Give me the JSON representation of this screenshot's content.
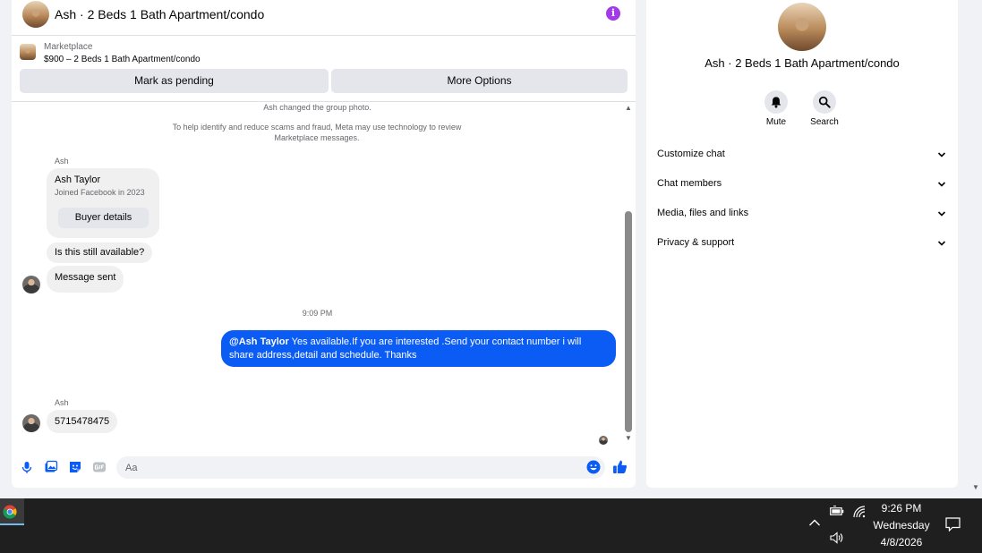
{
  "chat": {
    "title": "Ash · 2 Beds 1 Bath Apartment/condo",
    "listing": {
      "type": "Marketplace",
      "title": "$900 – 2 Beds 1 Bath Apartment/condo"
    },
    "actions": {
      "pending": "Mark as pending",
      "more": "More Options"
    },
    "system_messages": {
      "photo_changed": "Ash changed the group photo.",
      "scam_notice": "To help identify and reduce scams and fraud, Meta may use technology to review Marketplace messages."
    },
    "buyer_card": {
      "sender": "Ash",
      "name": "Ash Taylor",
      "joined": "Joined Facebook in 2023",
      "button": "Buyer details"
    },
    "messages_in_1": [
      "Is this still available?",
      "Message sent"
    ],
    "time_divider": "9:09 PM",
    "outgoing": {
      "mention": "@Ash Taylor",
      "text": "  Yes available.If you are interested .Send your contact number i will share address,detail and schedule. Thanks"
    },
    "last_sender": "Ash",
    "last_message": "5715478475",
    "composer": {
      "placeholder": "Aa"
    }
  },
  "info_panel": {
    "title": "Ash · 2 Beds 1 Bath Apartment/condo",
    "mute_label": "Mute",
    "search_label": "Search",
    "sections": [
      "Customize chat",
      "Chat members",
      "Media, files and links",
      "Privacy & support"
    ]
  },
  "taskbar": {
    "time": "9:26 PM",
    "day": "Wednesday",
    "date": "4/8/2026"
  },
  "colors": {
    "accent": "#0a5cf5",
    "info_icon": "#a33ae8",
    "bubble_in": "#f0f0f0",
    "taskbar": "#1f1f1f"
  },
  "icons": {
    "info": "info-icon",
    "mute": "bell-icon",
    "search": "search-icon",
    "composer": [
      "microphone-icon",
      "photo-icon",
      "sticker-icon",
      "gif-icon",
      "emoji-icon",
      "thumbs-up-icon"
    ],
    "tray": [
      "chevron-up-icon",
      "battery-icon",
      "wifi-icon",
      "volume-icon",
      "notifications-icon"
    ]
  }
}
